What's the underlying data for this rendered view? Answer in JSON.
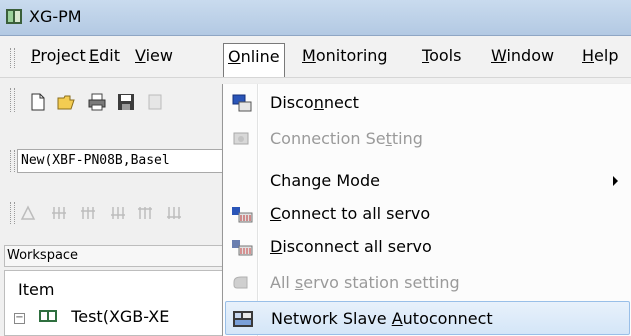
{
  "window": {
    "title": "XG-PM"
  },
  "menubar": {
    "items": [
      {
        "pre": "",
        "u": "P",
        "post": "roject"
      },
      {
        "pre": "",
        "u": "E",
        "post": "dit"
      },
      {
        "pre": "",
        "u": "V",
        "post": "iew"
      },
      {
        "pre": "",
        "u": "O",
        "post": "nline"
      },
      {
        "pre": "",
        "u": "M",
        "post": "onitoring"
      },
      {
        "pre": "",
        "u": "T",
        "post": "ools"
      },
      {
        "pre": "",
        "u": "W",
        "post": "indow"
      },
      {
        "pre": "",
        "u": "H",
        "post": "elp"
      }
    ],
    "active_index": 3
  },
  "toolbar": {
    "icons": [
      "new-file-icon",
      "open-folder-icon",
      "print-icon",
      "save-icon",
      "cut-icon"
    ]
  },
  "module_combo": {
    "value": "New(XBF-PN08B,Basel"
  },
  "workspace": {
    "title": "Workspace",
    "column_header": "Item",
    "project_item": "Test(XGB-XE"
  },
  "online_menu": {
    "items": [
      {
        "pre": "Disco",
        "u": "n",
        "post": "nect",
        "icon": "disconnect-icon",
        "disabled": false
      },
      {
        "pre": "Connection Se",
        "u": "t",
        "post": "ting",
        "icon": "connection-setting-icon",
        "disabled": true
      },
      {
        "pre": "Change Mode",
        "u": "",
        "post": "",
        "icon": "",
        "disabled": false,
        "submenu": true
      },
      {
        "pre": "",
        "u": "C",
        "post": "onnect to all servo",
        "icon": "connect-all-servo-icon",
        "disabled": false
      },
      {
        "pre": "",
        "u": "D",
        "post": "isconnect all servo",
        "icon": "disconnect-all-servo-icon",
        "disabled": false
      },
      {
        "pre": "All ",
        "u": "s",
        "post": "ervo station setting",
        "icon": "servo-station-setting-icon",
        "disabled": true
      },
      {
        "pre": "Network Slave ",
        "u": "A",
        "post": "utoconnect",
        "icon": "network-slave-autoconnect-icon",
        "disabled": false,
        "highlighted": true
      }
    ]
  },
  "colors": {
    "highlight": "#d4e6f8",
    "disabled_text": "#9a9a9a",
    "titlebar": "#c9dbee"
  }
}
